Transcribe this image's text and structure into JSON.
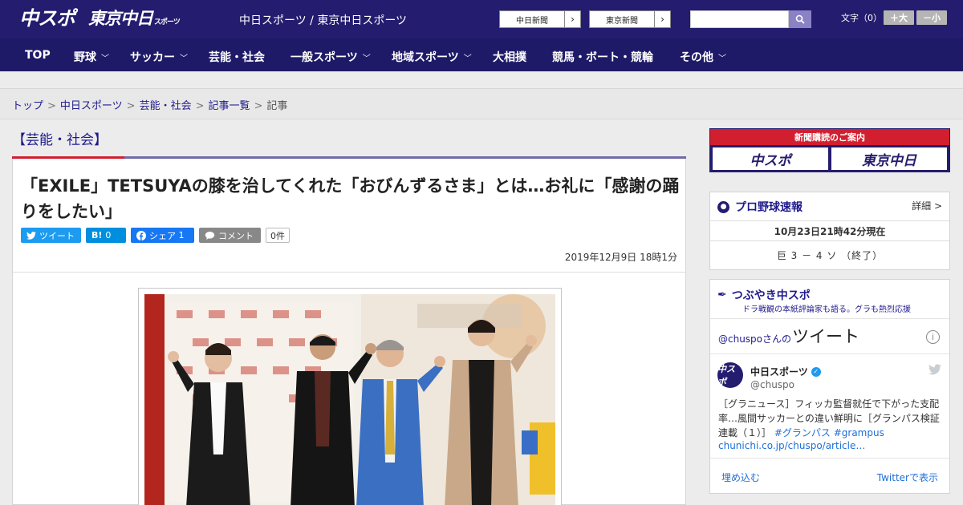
{
  "header": {
    "logo_chuspo": "中スポ",
    "logo_tokyo": "東京中日",
    "logo_tokyo_small": "スポーツ",
    "site_title": "中日スポーツ / 東京中日スポーツ",
    "paper_buttons": [
      {
        "label": "中日新聞",
        "arrow": "›"
      },
      {
        "label": "東京新聞",
        "arrow": "›"
      }
    ],
    "search_placeholder": "",
    "font_size_label": "文字（0）",
    "font_bigger": "＋大",
    "font_smaller": "－小"
  },
  "nav": {
    "items": [
      {
        "label": "TOP",
        "chev": ""
      },
      {
        "label": "野球",
        "chev": "﹀"
      },
      {
        "label": "サッカー",
        "chev": "﹀"
      },
      {
        "label": "芸能・社会",
        "chev": ""
      },
      {
        "label": "一般スポーツ",
        "chev": "﹀"
      },
      {
        "label": "地域スポーツ",
        "chev": "﹀"
      },
      {
        "label": "大相撲",
        "chev": ""
      },
      {
        "label": "競馬・ボート・競輪",
        "chev": ""
      },
      {
        "label": "その他",
        "chev": "﹀"
      }
    ]
  },
  "breadcrumb": {
    "items": [
      "トップ",
      "中日スポーツ",
      "芸能・社会",
      "記事一覧"
    ],
    "current": "記事",
    "sep": ">"
  },
  "article": {
    "section": "【芸能・社会】",
    "headline": "「EXILE」TETSUYAの膝を治してくれた「おびんずるさま」とは…お礼に「感謝の踊りをしたい」",
    "share": {
      "tweet": "ツイート",
      "hatena_icon": "B!",
      "hatena_count": "0",
      "facebook": "シェア",
      "facebook_count": "1",
      "comment": "コメント",
      "comment_count": "0件"
    },
    "date": "2019年12月9日 18時1分"
  },
  "sidebar": {
    "ad": {
      "title": "新聞購読のご案内",
      "logo1": "中スポ",
      "logo2": "東京中日"
    },
    "baseball": {
      "title": "プロ野球速報",
      "detail": "詳細 >",
      "time": "10月23日21時42分現在",
      "score": "巨 3 － 4 ソ （終了）"
    },
    "tweets": {
      "title": "つぶやき中スポ",
      "subtitle": "ドラ戦観の本紙評論家も語る。グラも熱烈応援",
      "account_prefix": "@chuspo",
      "account_suffix": "さんの",
      "header_big": "ツイート",
      "name": "中日スポーツ",
      "handle": "@chuspo",
      "text": "［グラニュース］フィッカ監督就任で下がった支配率…風間サッカーとの違い鮮明に［グランパス検証連載（１）］",
      "hashtags": "#グランパス #grampus",
      "link": "chunichi.co.jp/chuspo/article…",
      "embed": "埋め込む",
      "view": "Twitterで表示"
    }
  }
}
